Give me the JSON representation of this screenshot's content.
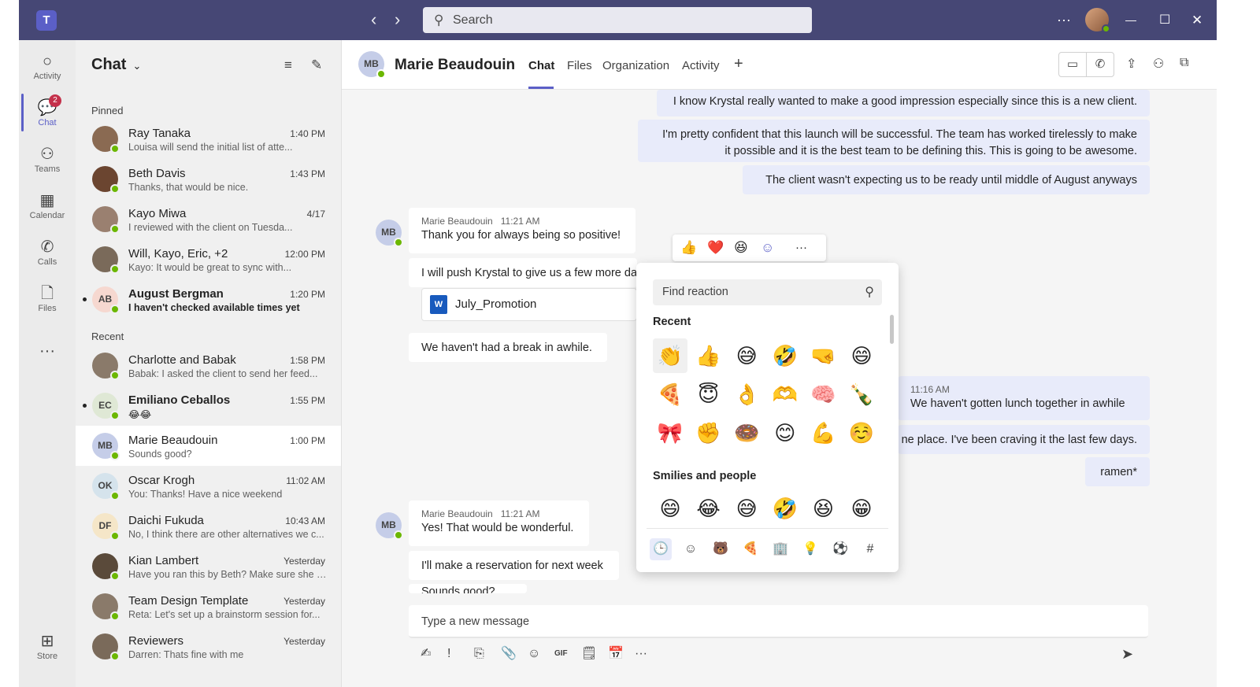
{
  "titlebar": {
    "logo": "T",
    "back": "‹",
    "forward": "›",
    "search_placeholder": "Search",
    "more": "···",
    "minimize": "—",
    "maximize": "☐",
    "close": "✕"
  },
  "rail": {
    "items": [
      {
        "label": "Activity",
        "icon": "bell-icon",
        "glyph": "○"
      },
      {
        "label": "Chat",
        "icon": "chat-icon",
        "glyph": "💬",
        "badge": "2"
      },
      {
        "label": "Teams",
        "icon": "teams-icon",
        "glyph": "⚇"
      },
      {
        "label": "Calendar",
        "icon": "calendar-icon",
        "glyph": "▦"
      },
      {
        "label": "Calls",
        "icon": "phone-icon",
        "glyph": "✆"
      },
      {
        "label": "Files",
        "icon": "file-icon",
        "glyph": "🗋"
      },
      {
        "label": "",
        "icon": "more-icon",
        "glyph": "···"
      },
      {
        "label": "Store",
        "icon": "store-icon",
        "glyph": "⊞"
      }
    ]
  },
  "chatlist": {
    "title": "Chat",
    "chevron": "⌄",
    "filter_icon": "≡",
    "compose_icon": "✎",
    "pinned_label": "Pinned",
    "recent_label": "Recent",
    "pinned": [
      {
        "name": "Ray Tanaka",
        "time": "1:40 PM",
        "preview": "Louisa will send the initial list of atte...",
        "color": "#8a6a52"
      },
      {
        "name": "Beth Davis",
        "time": "1:43 PM",
        "preview": "Thanks, that would be nice.",
        "color": "#6b4530"
      },
      {
        "name": "Kayo Miwa",
        "time": "4/17",
        "preview": "I reviewed with the client on Tuesda...",
        "color": "#9a8070"
      },
      {
        "name": "Will, Kayo, Eric, +2",
        "time": "12:00 PM",
        "preview": "Kayo: It would be great to sync with...",
        "color": "#7a6a5a"
      },
      {
        "name": "August Bergman",
        "time": "1:20 PM",
        "preview": "I haven't checked available times yet",
        "initials": "AB",
        "color": "#f6d8d0",
        "unread": true
      }
    ],
    "recent": [
      {
        "name": "Charlotte and Babak",
        "time": "1:58 PM",
        "preview": "Babak: I asked the client to send her feed...",
        "color": "#8a7a6a"
      },
      {
        "name": "Emiliano Ceballos",
        "time": "1:55 PM",
        "preview": "😂😂",
        "initials": "EC",
        "color": "#dfe8d5",
        "unread": true
      },
      {
        "name": "Marie Beaudouin",
        "time": "1:00 PM",
        "preview": "Sounds good?",
        "initials": "MB",
        "color": "#c5cde8",
        "selected": true
      },
      {
        "name": "Oscar Krogh",
        "time": "11:02 AM",
        "preview": "You: Thanks! Have a nice weekend",
        "initials": "OK",
        "color": "#d5e3ec"
      },
      {
        "name": "Daichi Fukuda",
        "time": "10:43 AM",
        "preview": "No, I think there are other alternatives we c...",
        "initials": "DF",
        "color": "#f5e6c8"
      },
      {
        "name": "Kian Lambert",
        "time": "Yesterday",
        "preview": "Have you ran this by Beth? Make sure she is...",
        "color": "#5a4a3a"
      },
      {
        "name": "Team Design Template",
        "time": "Yesterday",
        "preview": "Reta: Let's set up a brainstorm session for...",
        "color": "#8a7a6a"
      },
      {
        "name": "Reviewers",
        "time": "Yesterday",
        "preview": "Darren: Thats fine with me",
        "color": "#7a6a5a"
      }
    ]
  },
  "header": {
    "initials": "MB",
    "name": "Marie Beaudouin",
    "tabs": [
      "Chat",
      "Files",
      "Organization",
      "Activity"
    ],
    "add_tab": "+",
    "video_icon": "▭",
    "call_icon": "✆",
    "share_icon": "⇪",
    "people_icon": "⚇",
    "popout_icon": "⧉"
  },
  "messages": {
    "mine_top": [
      "I know Krystal really wanted to make a good impression especially since this is a new client.",
      "I'm pretty confident that this launch will be successful. The team has worked tirelessly to make",
      "it possible and it is the best team to be defining this. This is going to be awesome.",
      "The client wasn't expecting us to be ready until middle of August anyways"
    ],
    "group1": {
      "initials": "MB",
      "sender": "Marie Beaudouin",
      "time": "11:21 AM",
      "text": "Thank you for always being so positive!",
      "text2": "I will push Krystal to give us a few more days",
      "file": "July_Promotion",
      "file_icon": "W",
      "text3": "We haven't had a break in awhile."
    },
    "mine_mid": {
      "time": "11:16 AM",
      "text": "We haven't gotten lunch together in awhile",
      "text2": "ne place. I've been craving it the last few days.",
      "text3": "ramen*"
    },
    "group2": {
      "initials": "MB",
      "sender": "Marie Beaudouin",
      "time": "11:21 AM",
      "text": "Yes! That would be wonderful.",
      "text2": "I'll make a reservation for next week",
      "text3": "Sounds good?"
    }
  },
  "reactbar": {
    "reactions": [
      "👍",
      "❤️",
      "😆",
      "☺"
    ],
    "more": "···"
  },
  "picker": {
    "search_placeholder": "Find reaction",
    "search_icon": "⚲",
    "recent_label": "Recent",
    "smilies_label": "Smilies and people",
    "recent": [
      "👏",
      "👍",
      "😅",
      "🤣",
      "🤜",
      "😄",
      "🍕",
      "😇",
      "👌",
      "🫶",
      "🧠",
      "🍾",
      "🎀",
      "✊",
      "🍩",
      "😊",
      "💪",
      "☺️"
    ],
    "smilies": [
      "😄",
      "😂",
      "😅",
      "🤣",
      "😆",
      "😁"
    ],
    "categories": [
      "🕒",
      "☺",
      "🐻",
      "🍕",
      "🏢",
      "💡",
      "⚽",
      "#"
    ]
  },
  "compose": {
    "placeholder": "Type a new message",
    "tools": [
      "✍",
      "!",
      "⎘",
      "📎",
      "☺",
      "GIF",
      "🗒",
      "📅",
      "···"
    ],
    "send": "➤"
  }
}
